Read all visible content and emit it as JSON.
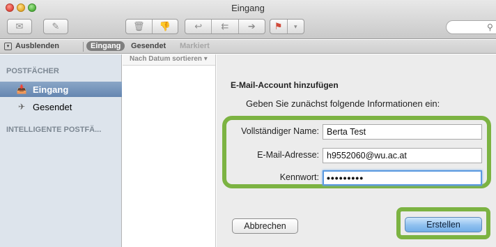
{
  "window": {
    "title": "Eingang"
  },
  "favorites": {
    "hide_label": "Ausblenden",
    "inbox_label": "Eingang",
    "sent_label": "Gesendet",
    "flagged_label": "Markiert"
  },
  "sidebar": {
    "mailboxes_header": "POSTFÄCHER",
    "items": [
      {
        "label": "Eingang",
        "icon": "inbox-icon",
        "selected": true
      },
      {
        "label": "Gesendet",
        "icon": "sent-icon",
        "selected": false
      }
    ],
    "smart_header": "INTELLIGENTE POSTFÄ..."
  },
  "message_list": {
    "sort_label": "Nach Datum sortieren ▾"
  },
  "sheet": {
    "title": "E-Mail-Account hinzufügen",
    "subtitle": "Geben Sie zunächst folgende Informationen ein:",
    "fields": {
      "name_label": "Vollständiger Name:",
      "name_value": "Berta Test",
      "email_label": "E-Mail-Adresse:",
      "email_value": "h9552060@wu.ac.at",
      "password_label": "Kennwort:",
      "password_value": "•••••••••"
    },
    "cancel_label": "Abbrechen",
    "create_label": "Erstellen"
  },
  "colors": {
    "highlight": "#7cb342",
    "focus": "#5b9ae0",
    "sidebar_bg": "#dde4ec"
  }
}
